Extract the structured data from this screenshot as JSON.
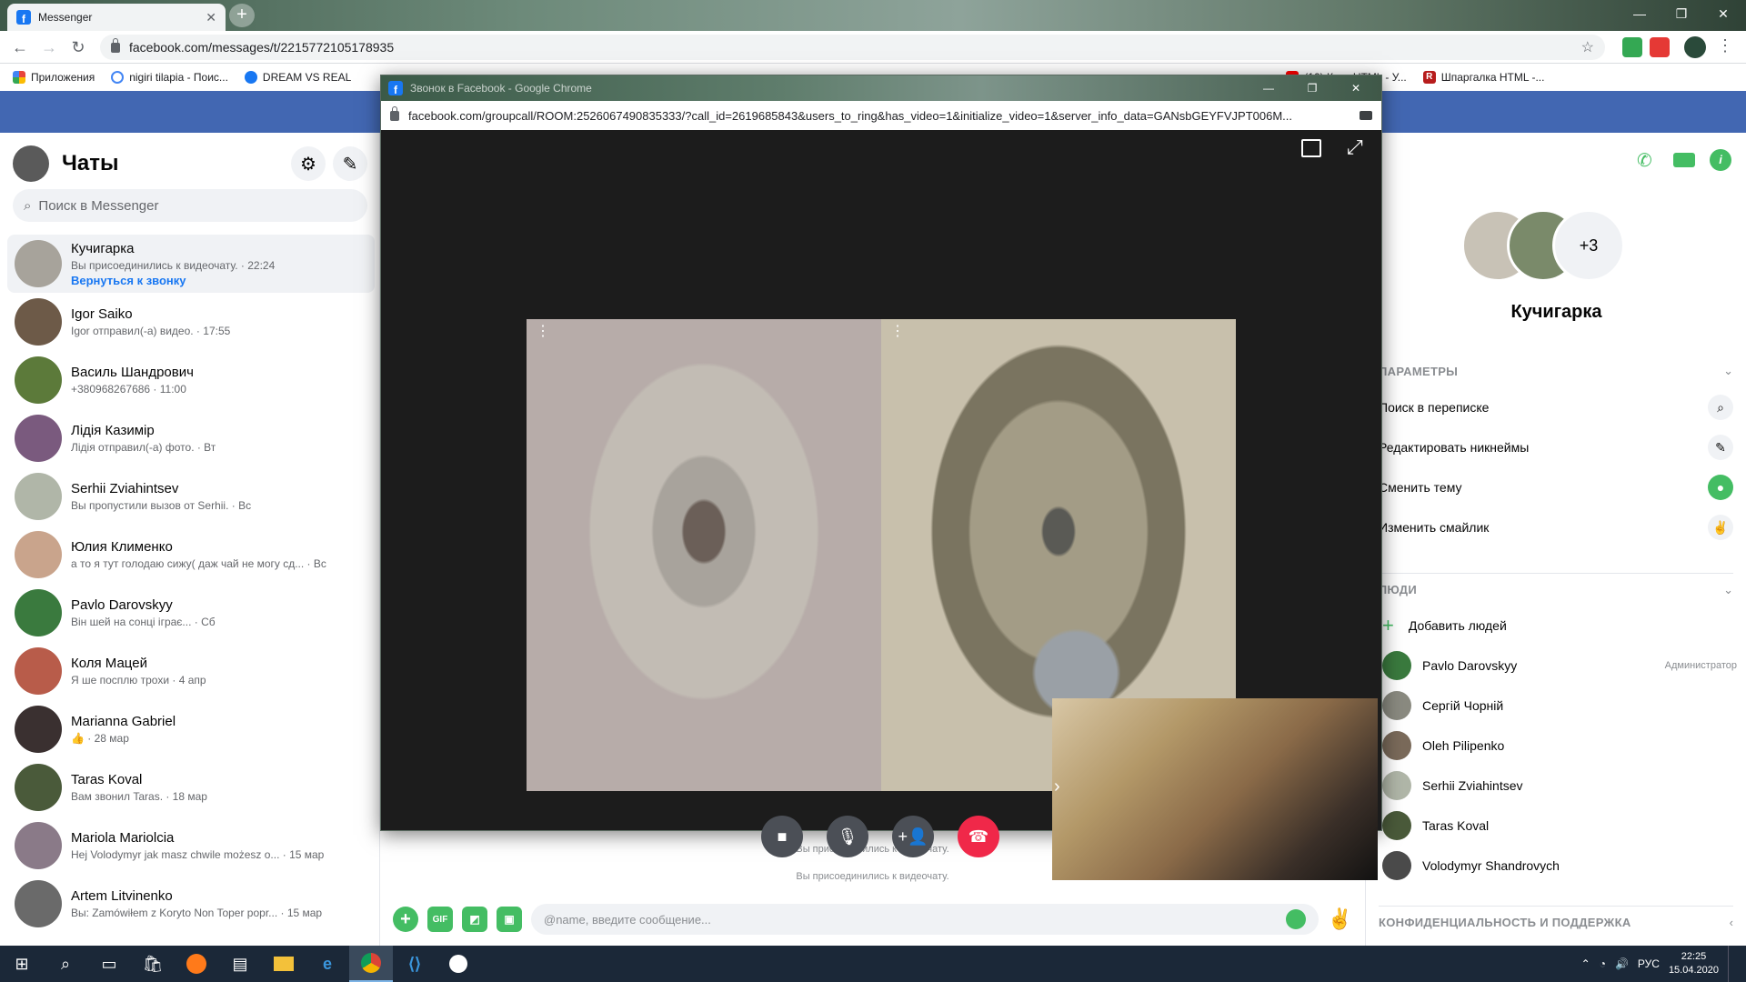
{
  "browser": {
    "tab_title": "Messenger",
    "url": "facebook.com/messages/t/2215772105178935",
    "bookmarks": [
      {
        "label": "Приложения",
        "icon": "apps-icon",
        "color": "#e8453c"
      },
      {
        "label": "nigiri tilapia - Поис...",
        "icon": "google-icon",
        "color": "#4285f4"
      },
      {
        "label": "DREAM VS REAL",
        "icon": "facebook-icon",
        "color": "#1877f2"
      },
      {
        "label": "(10) Курс HTML - У...",
        "icon": "youtube-icon",
        "color": "#ff0000"
      },
      {
        "label": "Шпаргалка HTML -...",
        "icon": "r-icon",
        "color": "#b71c1c"
      }
    ]
  },
  "sidebar": {
    "title": "Чаты",
    "search_placeholder": "Поиск в Messenger",
    "chats": [
      {
        "name": "Кучигарка",
        "preview": "Вы присоединились к видеочату. · 22:24",
        "action": "Вернуться к звонку",
        "avatar_color": "#a7a39b",
        "active": true
      },
      {
        "name": "Igor Saiko",
        "preview": "Igor отправил(-а) видео. · 17:55",
        "avatar_color": "#6d5a48"
      },
      {
        "name": "Василь Шандрович",
        "preview": "+380968267686 · 11:00",
        "avatar_color": "#5c7a3a"
      },
      {
        "name": "Лідія Казимір",
        "preview": "Лідія отправил(-а) фото. · Вт",
        "avatar_color": "#7a5a7e"
      },
      {
        "name": "Serhii Zviahintsev",
        "preview": "Вы пропустили вызов от Serhii. · Вс",
        "avatar_color": "#b0b6a8"
      },
      {
        "name": "Юлия Клименко",
        "preview": "а то я тут голодаю сижу( даж чай не могу сд... · Вс",
        "avatar_color": "#c9a48c"
      },
      {
        "name": "Pavlo Darovskyy",
        "preview": "Він шей на сонці іграє... · Сб",
        "avatar_color": "#3a7a3e"
      },
      {
        "name": "Коля Мацей",
        "preview": "Я ше посплю трохи · 4 апр",
        "avatar_color": "#b85c4a"
      },
      {
        "name": "Marianna Gabriel",
        "preview": "👍 · 28 мар",
        "avatar_color": "#3a3030"
      },
      {
        "name": "Taras Koval",
        "preview": "Вам звонил Taras. · 18 мар",
        "avatar_color": "#4a5a3a"
      },
      {
        "name": "Mariola Mariolcia",
        "preview": "Hej Volodymyr jak masz chwile możesz o... · 15 мар",
        "avatar_color": "#8a7a88"
      },
      {
        "name": "Artem Litvinenko",
        "preview": "Вы: Zamówiłem z Koryto Non Toper popr... · 15 мар",
        "avatar_color": "#6a6a6a"
      }
    ]
  },
  "center": {
    "system_messages": [
      "Вы присоединились к видеочату.",
      "Вы присоединились к видеочату."
    ],
    "composer_placeholder": "@name, введите сообщение...",
    "gif_label": "GIF"
  },
  "right": {
    "extra_count": "+3",
    "conversation_name": "Кучигарка",
    "params_header": "ПАРАМЕТРЫ",
    "options": [
      {
        "label": "Поиск в переписке",
        "icon": "search-icon"
      },
      {
        "label": "Редактировать никнеймы",
        "icon": "pencil-icon"
      },
      {
        "label": "Сменить тему",
        "icon": "theme-icon"
      },
      {
        "label": "Изменить смайлик",
        "icon": "victory-hand-icon"
      }
    ],
    "people_header": "ЛЮДИ",
    "add_people": "Добавить людей",
    "people": [
      {
        "name": "Pavlo Darovskyy",
        "role": "Администратор",
        "avatar_color": "#3a7a3e"
      },
      {
        "name": "Сергій Чорній",
        "role": "",
        "avatar_color": "#8a8a80"
      },
      {
        "name": "Oleh Pilipenko",
        "role": "",
        "avatar_color": "#7a6a5a"
      },
      {
        "name": "Serhii Zviahintsev",
        "role": "",
        "avatar_color": "#b0b6a8"
      },
      {
        "name": "Taras Koval",
        "role": "",
        "avatar_color": "#4a5a3a"
      },
      {
        "name": "Volodymyr Shandrovych",
        "role": "",
        "avatar_color": "#4a4a4a"
      }
    ],
    "privacy_header": "КОНФИДЕНЦИАЛЬНОСТЬ И ПОДДЕРЖКА"
  },
  "popup": {
    "title": "Звонок в Facebook - Google Chrome",
    "url": "facebook.com/groupcall/ROOM:2526067490835333/?call_id=2619685843&users_to_ring&has_video=1&initialize_video=1&server_info_data=GANsbGEYFVJPT006M..."
  },
  "taskbar": {
    "lang": "РУС",
    "time": "22:25",
    "date": "15.04.2020"
  }
}
